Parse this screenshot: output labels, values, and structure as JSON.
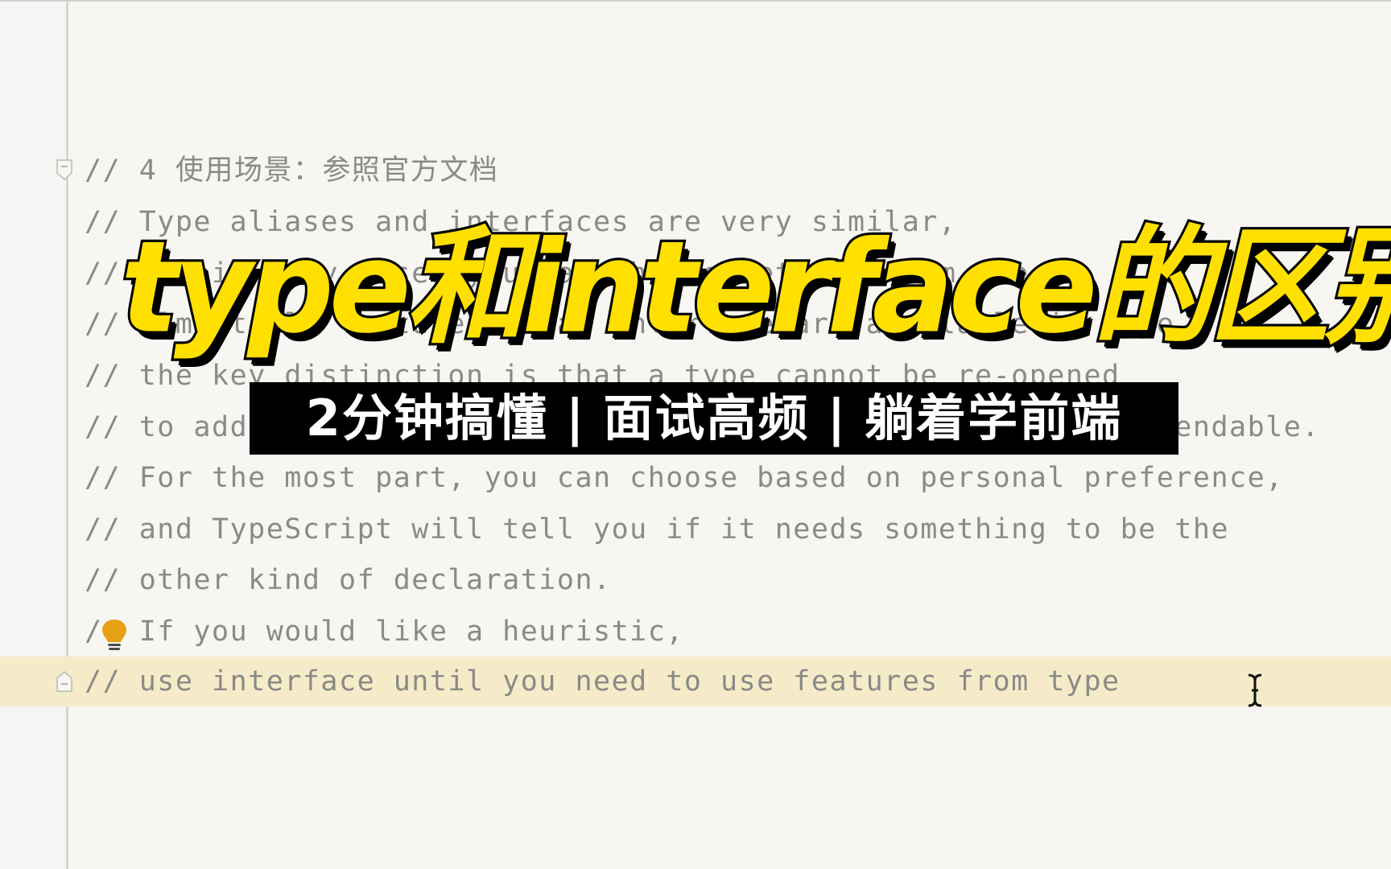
{
  "editor": {
    "lines": [
      "// 4 使用场景：参照官方文档",
      "// Type aliases and interfaces are very similar,",
      "// and in many cases you can choose between them freely.",
      "// Almost all features of an interface are available in type,",
      "// the key distinction is that a type cannot be re-opened",
      "// to add new properties vs an interface which is always extendable.",
      "// For the most part, you can choose based on personal preference,",
      "// and TypeScript will tell you if it needs something to be the",
      "// other kind of declaration.",
      "/  If you would like a heuristic,",
      "// use interface until you need to use features from type"
    ],
    "current_line_index": 10,
    "colors": {
      "comment": "#8a8a86",
      "background": "#f7f6f2",
      "current_line": "#f5ebc8",
      "bulb": "#e8a013"
    }
  },
  "overlay": {
    "title": "type和interface的区别",
    "banner_parts": [
      "2分钟搞懂",
      "|",
      "面试高频",
      "|",
      "躺着学前端"
    ],
    "title_color": "#ffe000"
  },
  "icons": {
    "fold_start": "fold-collapse-icon",
    "fold_end": "fold-end-icon",
    "intention": "lightbulb-icon",
    "cursor": "text-cursor-icon"
  }
}
